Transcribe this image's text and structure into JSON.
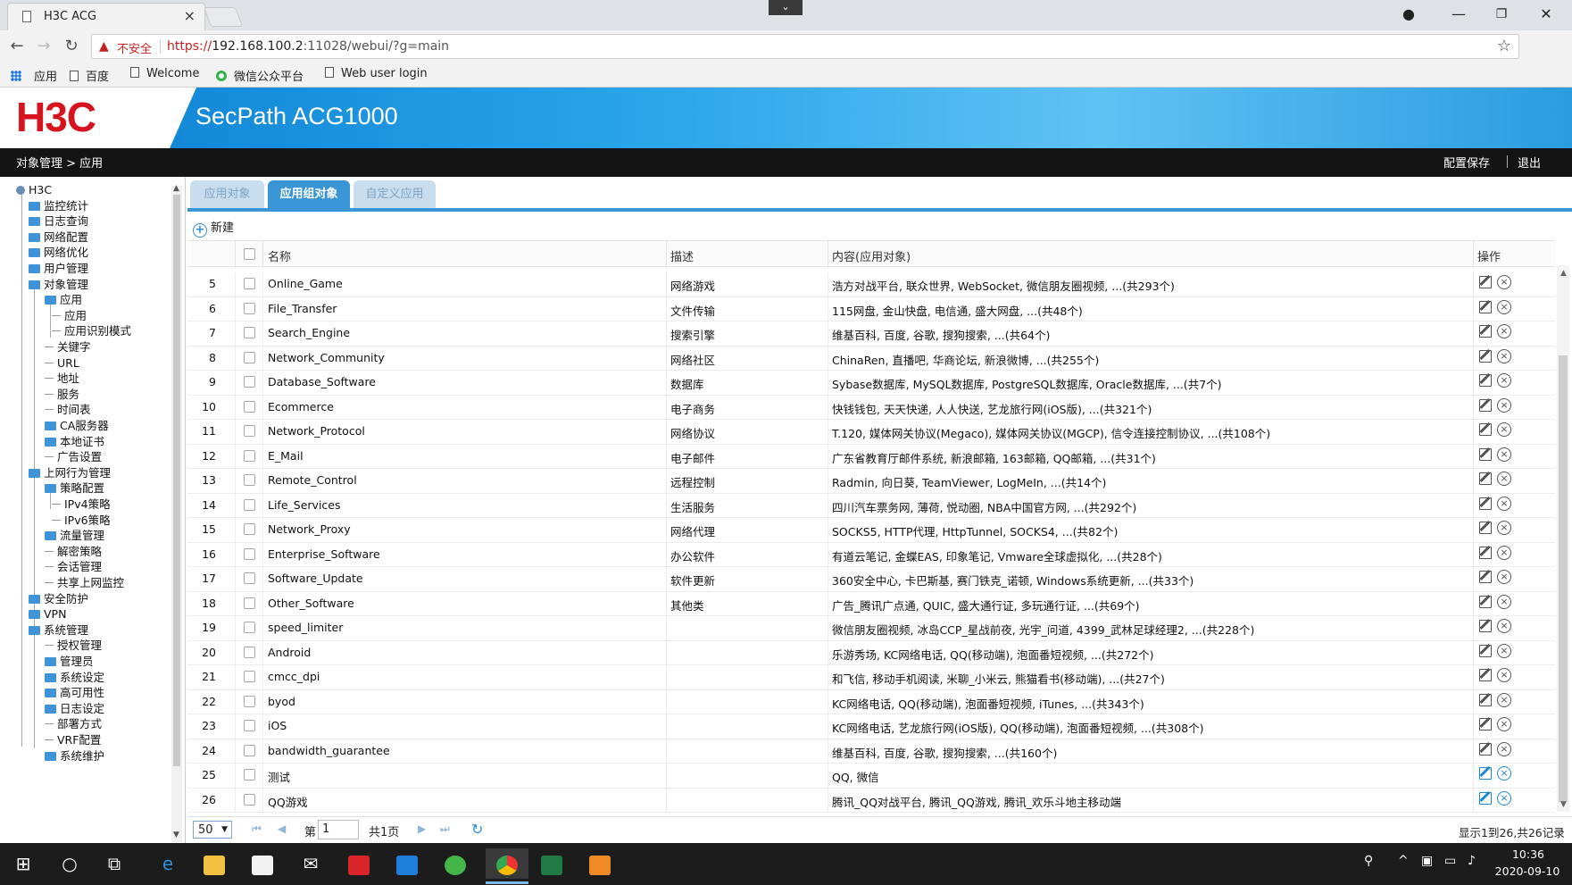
{
  "browser": {
    "tab_title": "H3C ACG",
    "tab_close": "×",
    "insecure_label": "不安全",
    "url_scheme": "https://",
    "url_host": "192.168.100.2",
    "url_rest": ":11028/webui/?g=main",
    "bookmarks": [
      {
        "label": "应用"
      },
      {
        "label": "百度"
      },
      {
        "label": "Welcome"
      },
      {
        "label": "微信公众平台"
      },
      {
        "label": "Web user login"
      }
    ]
  },
  "app": {
    "logo": "H3C",
    "product": "SecPath ACG1000",
    "breadcrumb": "对象管理 > 应用",
    "save_config": "配置保存",
    "logout": "退出"
  },
  "sidebar": {
    "items": [
      {
        "label": "H3C",
        "icon": "device-icon"
      },
      {
        "label": "监控统计",
        "icon": "folder-icon"
      },
      {
        "label": "日志查询",
        "icon": "folder-icon"
      },
      {
        "label": "网络配置",
        "icon": "folder-icon"
      },
      {
        "label": "网络优化",
        "icon": "folder-icon"
      },
      {
        "label": "用户管理",
        "icon": "folder-icon"
      },
      {
        "label": "对象管理",
        "icon": "folder-icon"
      },
      {
        "label": "应用",
        "icon": "folder-icon"
      },
      {
        "label": "应用",
        "icon": ""
      },
      {
        "label": "应用识别模式",
        "icon": ""
      },
      {
        "label": "关键字",
        "icon": ""
      },
      {
        "label": "URL",
        "icon": ""
      },
      {
        "label": "地址",
        "icon": ""
      },
      {
        "label": "服务",
        "icon": ""
      },
      {
        "label": "时间表",
        "icon": ""
      },
      {
        "label": "CA服务器",
        "icon": "folder-icon"
      },
      {
        "label": "本地证书",
        "icon": "folder-icon"
      },
      {
        "label": "广告设置",
        "icon": ""
      },
      {
        "label": "上网行为管理",
        "icon": "folder-icon"
      },
      {
        "label": "策略配置",
        "icon": "folder-icon"
      },
      {
        "label": "IPv4策略",
        "icon": ""
      },
      {
        "label": "IPv6策略",
        "icon": ""
      },
      {
        "label": "流量管理",
        "icon": "folder-icon"
      },
      {
        "label": "解密策略",
        "icon": ""
      },
      {
        "label": "会话管理",
        "icon": ""
      },
      {
        "label": "共享上网监控",
        "icon": ""
      },
      {
        "label": "安全防护",
        "icon": "folder-icon"
      },
      {
        "label": "VPN",
        "icon": "folder-icon"
      },
      {
        "label": "系统管理",
        "icon": "folder-icon"
      },
      {
        "label": "授权管理",
        "icon": ""
      },
      {
        "label": "管理员",
        "icon": "folder-icon"
      },
      {
        "label": "系统设定",
        "icon": "folder-icon"
      },
      {
        "label": "高可用性",
        "icon": "folder-icon"
      },
      {
        "label": "日志设定",
        "icon": "folder-icon"
      },
      {
        "label": "部署方式",
        "icon": ""
      },
      {
        "label": "VRF配置",
        "icon": ""
      },
      {
        "label": "系统维护",
        "icon": "folder-icon"
      }
    ]
  },
  "tabs": [
    {
      "label": "应用对象",
      "active": false
    },
    {
      "label": "应用组对象",
      "active": true
    },
    {
      "label": "自定义应用",
      "active": false
    }
  ],
  "toolbar": {
    "new_label": "新建"
  },
  "grid": {
    "headers": {
      "name": "名称",
      "desc": "描述",
      "content": "内容(应用对象)",
      "ops": "操作"
    },
    "rows": [
      {
        "num": "5",
        "name": "Online_Game",
        "desc": "网络游戏",
        "content": "浩方对战平台, 联众世界, WebSocket, 微信朋友圈视频, ...(共293个)"
      },
      {
        "num": "6",
        "name": "File_Transfer",
        "desc": "文件传输",
        "content": "115网盘, 金山快盘, 电信通, 盛大网盘, ...(共48个)"
      },
      {
        "num": "7",
        "name": "Search_Engine",
        "desc": "搜索引擎",
        "content": "维基百科, 百度, 谷歌, 搜狗搜索, ...(共64个)"
      },
      {
        "num": "8",
        "name": "Network_Community",
        "desc": "网络社区",
        "content": "ChinaRen, 直播吧, 华商论坛, 新浪微博, ...(共255个)"
      },
      {
        "num": "9",
        "name": "Database_Software",
        "desc": "数据库",
        "content": "Sybase数据库, MySQL数据库, PostgreSQL数据库, Oracle数据库, ...(共7个)"
      },
      {
        "num": "10",
        "name": "Ecommerce",
        "desc": "电子商务",
        "content": "快钱钱包, 天天快递, 人人快送, 艺龙旅行网(iOS版), ...(共321个)"
      },
      {
        "num": "11",
        "name": "Network_Protocol",
        "desc": "网络协议",
        "content": "T.120, 媒体网关协议(Megaco), 媒体网关协议(MGCP), 信令连接控制协议, ...(共108个)"
      },
      {
        "num": "12",
        "name": "E_Mail",
        "desc": "电子邮件",
        "content": "广东省教育厅邮件系统, 新浪邮箱, 163邮箱, QQ邮箱, ...(共31个)"
      },
      {
        "num": "13",
        "name": "Remote_Control",
        "desc": "远程控制",
        "content": "Radmin, 向日葵, TeamViewer, LogMeIn, ...(共14个)"
      },
      {
        "num": "14",
        "name": "Life_Services",
        "desc": "生活服务",
        "content": "四川汽车票务网, 薄荷, 悦动圈, NBA中国官方网, ...(共292个)"
      },
      {
        "num": "15",
        "name": "Network_Proxy",
        "desc": "网络代理",
        "content": "SOCKS5, HTTP代理, HttpTunnel, SOCKS4, ...(共82个)"
      },
      {
        "num": "16",
        "name": "Enterprise_Software",
        "desc": "办公软件",
        "content": "有道云笔记, 金蝶EAS, 印象笔记, Vmware全球虚拟化, ...(共28个)"
      },
      {
        "num": "17",
        "name": "Software_Update",
        "desc": "软件更新",
        "content": "360安全中心, 卡巴斯基, 赛门铁克_诺顿, Windows系统更新, ...(共33个)"
      },
      {
        "num": "18",
        "name": "Other_Software",
        "desc": "其他类",
        "content": "广告_腾讯广点通, QUIC, 盛大通行证, 多玩通行证, ...(共69个)"
      },
      {
        "num": "19",
        "name": "speed_limiter",
        "desc": "",
        "content": "微信朋友圈视频, 冰岛CCP_星战前夜, 光宇_问道, 4399_武林足球经理2, ...(共228个)"
      },
      {
        "num": "20",
        "name": "Android",
        "desc": "",
        "content": "乐游秀场, KC网络电话, QQ(移动端), 泡面番短视频, ...(共272个)"
      },
      {
        "num": "21",
        "name": "cmcc_dpi",
        "desc": "",
        "content": "和飞信, 移动手机阅读, 米聊_小米云, 熊猫看书(移动端), ...(共27个)"
      },
      {
        "num": "22",
        "name": "byod",
        "desc": "",
        "content": "KC网络电话, QQ(移动端), 泡面番短视频, iTunes, ...(共343个)"
      },
      {
        "num": "23",
        "name": "iOS",
        "desc": "",
        "content": "KC网络电话, 艺龙旅行网(iOS版), QQ(移动端), 泡面番短视频, ...(共308个)"
      },
      {
        "num": "24",
        "name": "bandwidth_guarantee",
        "desc": "",
        "content": "维基百科, 百度, 谷歌, 搜狗搜索, ...(共160个)"
      },
      {
        "num": "25",
        "name": "测试",
        "desc": "",
        "content": "QQ, 微信",
        "ops_highlight": true
      },
      {
        "num": "26",
        "name": "QQ游戏",
        "desc": "",
        "content": "腾讯_QQ对战平台, 腾讯_QQ游戏, 腾讯_欢乐斗地主移动端",
        "ops_highlight": true
      }
    ]
  },
  "pager": {
    "page_size": "50",
    "page_prefix": "第",
    "page_value": "1",
    "page_total": "共1页",
    "record_info": "显示1到26,共26记录"
  },
  "taskbar": {
    "time": "10:36",
    "date": "2020-09-10"
  },
  "colors": {
    "accent": "#3a95d6",
    "logo_red": "#d7131e",
    "header_dark": "#141414"
  }
}
